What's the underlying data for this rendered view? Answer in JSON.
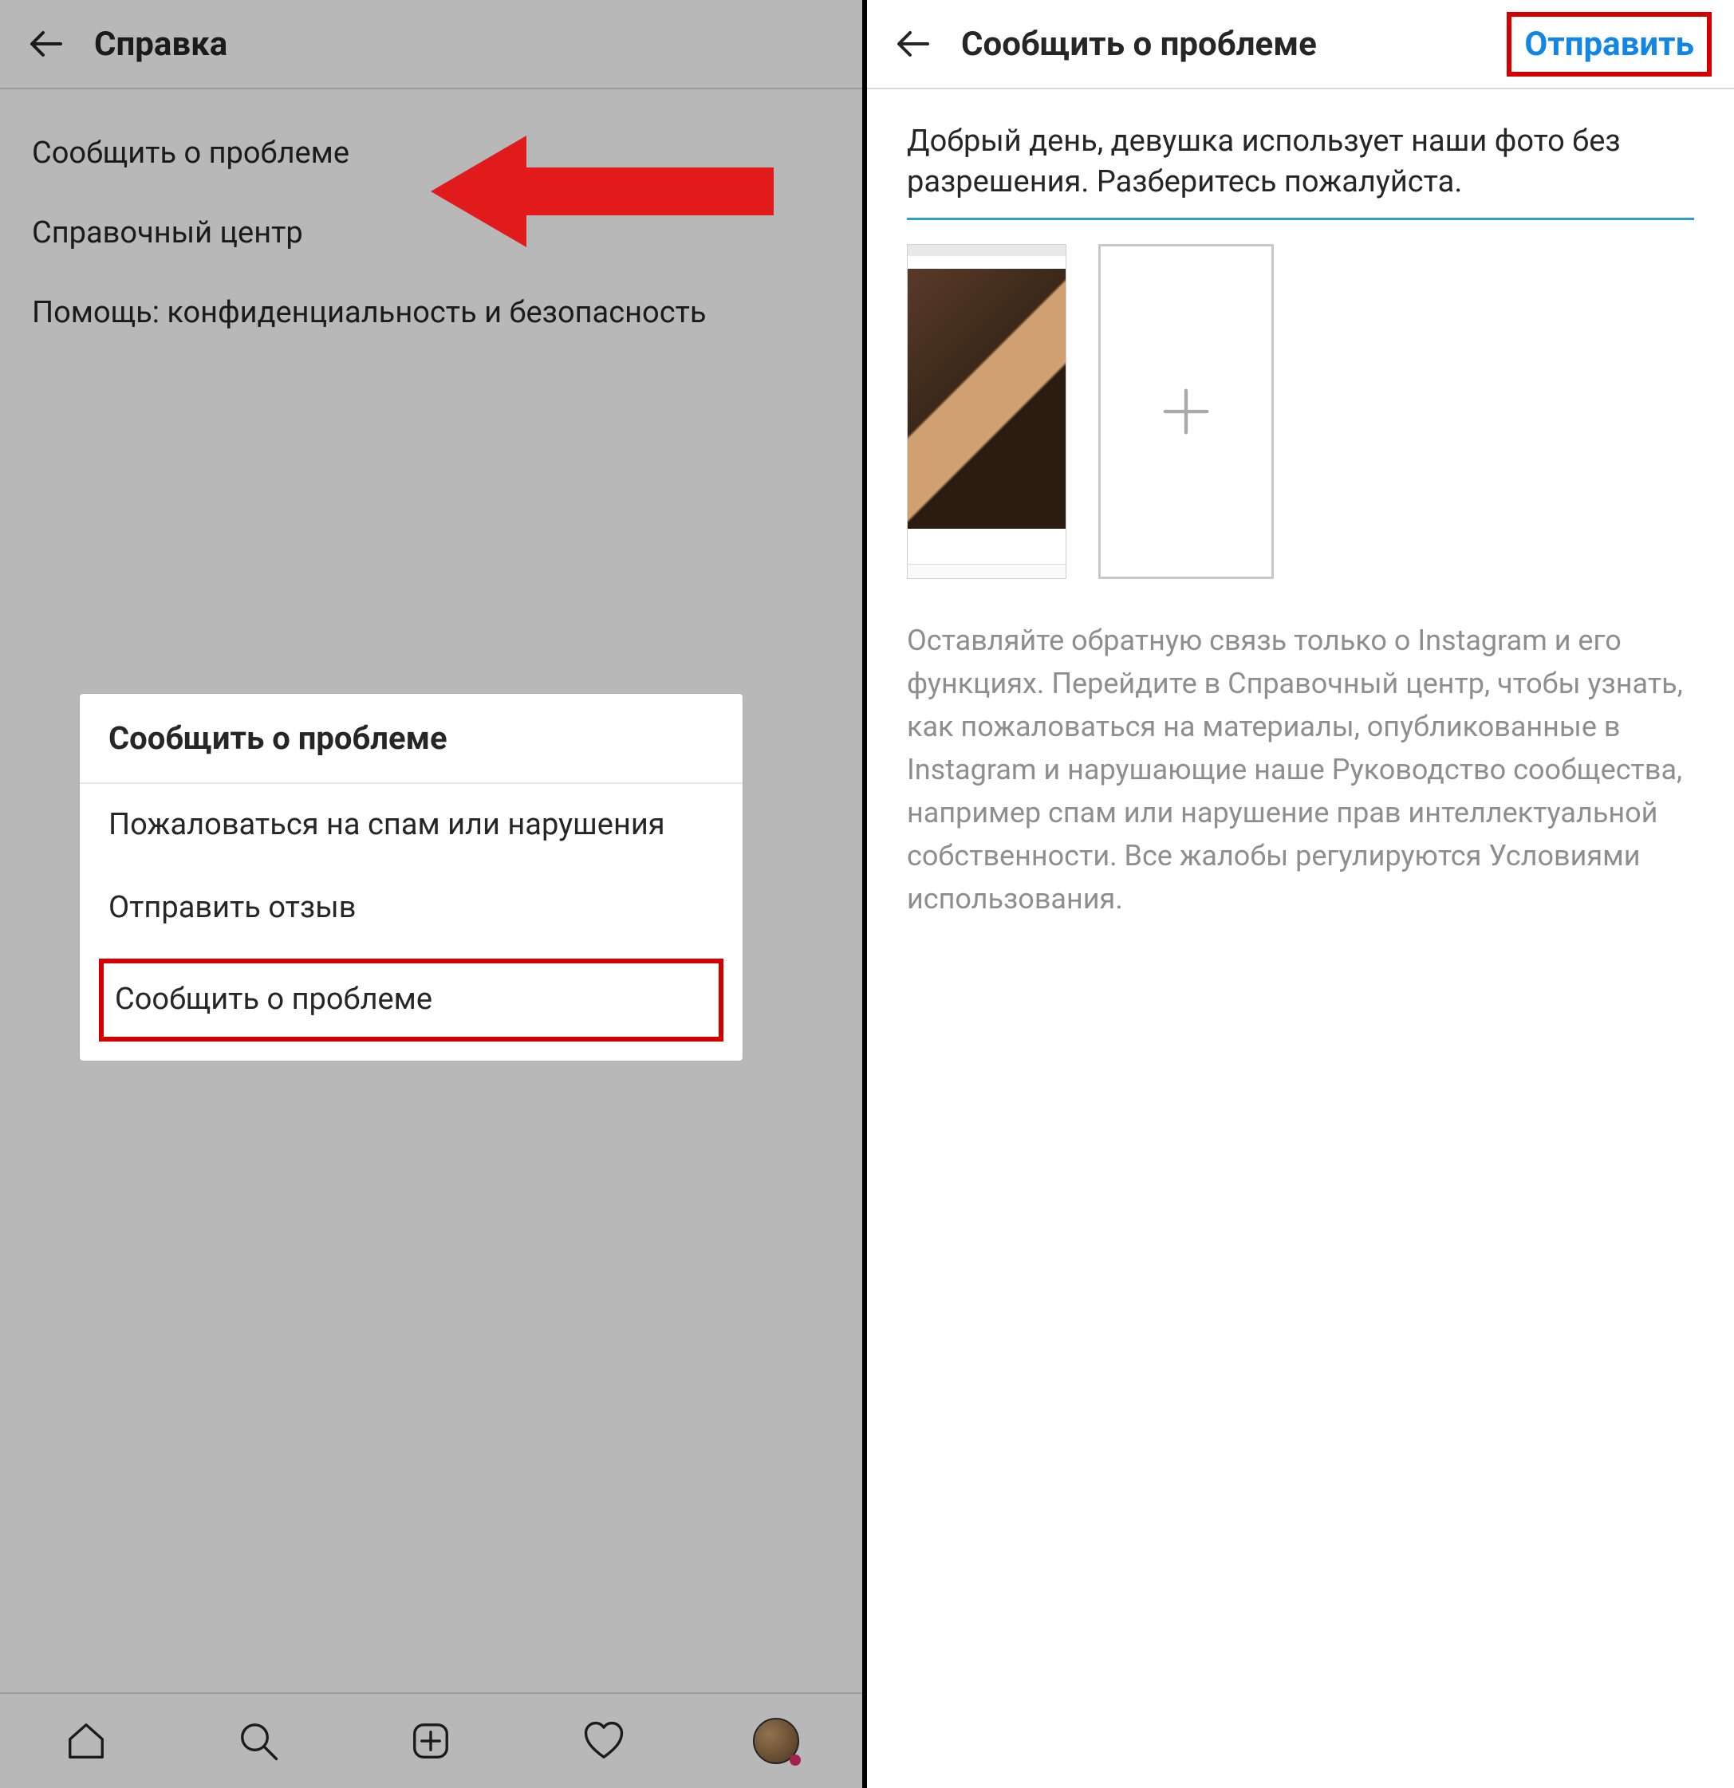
{
  "left": {
    "header_title": "Справка",
    "menu": [
      "Сообщить  о проблеме",
      "Справочный центр",
      "Помощь: конфиденциальность и безопасность"
    ],
    "dialog": {
      "title": "Сообщить  о проблеме",
      "items": [
        "Пожаловаться на спам или нарушения",
        "Отправить отзыв",
        "Сообщить о проблеме"
      ]
    }
  },
  "right": {
    "header_title": "Сообщить о проблеме",
    "send_label": "Отправить",
    "report_text": "Добрый день, девушка использует наши фото без разрешения. Разберитесь пожалуйста.",
    "helper_text": "Оставляйте обратную связь только о Instagram и его функциях. Перейдите в Справочный центр, чтобы узнать, как пожаловаться на материалы, опубликованные в Instagram и нарушающие наше Руководство сообщества, например спам или нарушение прав интеллектуальной собственности. Все жалобы регулируются Условиями использования."
  }
}
